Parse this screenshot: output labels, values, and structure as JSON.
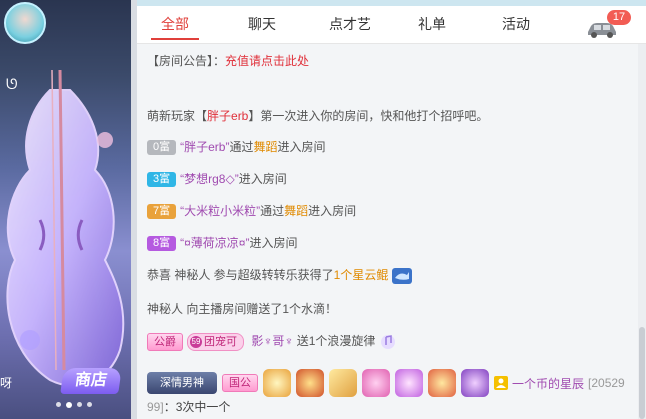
{
  "tabs": [
    {
      "label": "全部",
      "active": true
    },
    {
      "label": "聊天",
      "active": false
    },
    {
      "label": "点才艺",
      "active": false
    },
    {
      "label": "礼单",
      "active": false
    },
    {
      "label": "活动",
      "active": false
    }
  ],
  "notification_count": "17",
  "left_panel": {
    "corner_text": "呀",
    "shop_label": "商店"
  },
  "announcement": {
    "prefix": "【房间公告】：",
    "link": "充值请点击此处"
  },
  "welcome": {
    "pre": "萌新玩家【",
    "name": "胖子erb",
    "post": "】第一次进入你的房间，快和他打个招呼吧。"
  },
  "entries": [
    {
      "badge": "0富",
      "name": "“胖子erb”",
      "mid": "通过",
      "via": "舞蹈",
      "tail": "进入房间"
    },
    {
      "badge": "3富",
      "name": "“梦想rg8◇”",
      "tail": "进入房间"
    },
    {
      "badge": "7富",
      "name": "“大米粒小米粒”",
      "mid": "通过",
      "via": "舞蹈",
      "tail": "进入房间"
    },
    {
      "badge": "8富",
      "name": "“¤薄荷凉凉¤”",
      "tail": "进入房间"
    }
  ],
  "congrats": {
    "pre": "恭喜 神秘人 参与超级转转乐获得了",
    "prize": "1个星云鲲"
  },
  "gift_msg": "神秘人 向主播房间赠送了1个水滴！",
  "wave": {
    "badge1": "公爵",
    "badge2_num": "59",
    "badge2": "团宠可",
    "name": "影♆哥♆",
    "text": "送1个浪漫旋律"
  },
  "bottom": {
    "badge_name": "深情男神",
    "badge_guild": "国公",
    "user": "一个币的星辰",
    "id_a": "[20529",
    "id_b": "99]",
    "msg": "：3次中一个"
  },
  "colors": {
    "accent": "#e0403b",
    "name_purple": "#a04bb0",
    "link_red": "#e0303a"
  }
}
